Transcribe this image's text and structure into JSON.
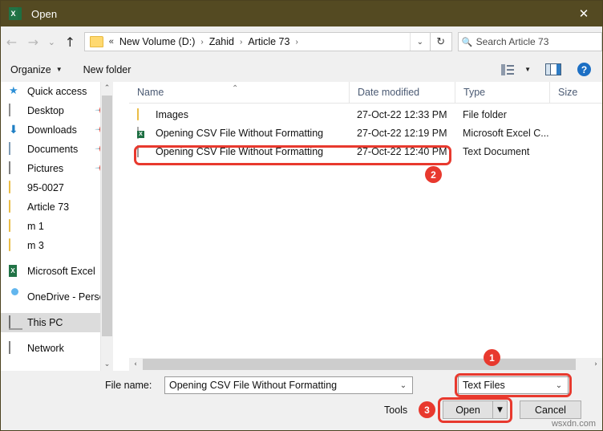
{
  "window": {
    "title": "Open",
    "app_icon": "excel-icon",
    "close_label": "✕",
    "titlebar_color": "#544a22"
  },
  "nav": {
    "back": "←",
    "forward": "→",
    "recent": "⌄",
    "up": "↑",
    "breadcrumb_overflow": "«",
    "breadcrumb": [
      "New Volume (D:)",
      "Zahid",
      "Article 73"
    ],
    "separator": "›",
    "dropdown": "⌄",
    "refresh": "↻",
    "search_placeholder": "Search Article 73",
    "search_value": "",
    "search_icon": "search-icon"
  },
  "toolbar": {
    "organize_label": "Organize",
    "organize_caret": "▼",
    "new_folder_label": "New folder",
    "view_caret": "▼",
    "view_icon": "list-view-icon",
    "preview_pane_icon": "preview-pane-icon",
    "help_label": "?"
  },
  "sidebar": {
    "items": [
      {
        "label": "Quick access",
        "icon": "star-icon",
        "pinned": false,
        "selected": false
      },
      {
        "label": "Desktop",
        "icon": "desktop-icon",
        "pinned": true,
        "selected": false
      },
      {
        "label": "Downloads",
        "icon": "download-icon",
        "pinned": true,
        "selected": false
      },
      {
        "label": "Documents",
        "icon": "documents-icon",
        "pinned": true,
        "selected": false
      },
      {
        "label": "Pictures",
        "icon": "pictures-icon",
        "pinned": true,
        "selected": false
      },
      {
        "label": "95-0027",
        "icon": "folder-icon",
        "pinned": false,
        "selected": false
      },
      {
        "label": "Article 73",
        "icon": "folder-icon",
        "pinned": false,
        "selected": false
      },
      {
        "label": "m 1",
        "icon": "folder-icon",
        "pinned": false,
        "selected": false
      },
      {
        "label": "m 3",
        "icon": "folder-icon",
        "pinned": false,
        "selected": false
      },
      {
        "label": "Microsoft Excel",
        "icon": "excel-icon",
        "pinned": false,
        "selected": false
      },
      {
        "label": "OneDrive - Personal",
        "icon": "onedrive-icon",
        "pinned": false,
        "selected": false
      },
      {
        "label": "This PC",
        "icon": "this-pc-icon",
        "pinned": false,
        "selected": true
      },
      {
        "label": "Network",
        "icon": "network-icon",
        "pinned": false,
        "selected": false
      }
    ],
    "scroll_up": "⌃",
    "scroll_down": "⌄"
  },
  "filelist": {
    "columns": [
      "Name",
      "Date modified",
      "Type",
      "Size"
    ],
    "sort_indicator": "⌃",
    "rows": [
      {
        "name": "Images",
        "date_modified": "27-Oct-22 12:33 PM",
        "type": "File folder",
        "size": "",
        "icon": "folder-icon"
      },
      {
        "name": "Opening CSV File Without Formatting",
        "date_modified": "27-Oct-22 12:19 PM",
        "type": "Microsoft Excel C...",
        "size": "",
        "icon": "excel-csv-icon"
      },
      {
        "name": "Opening CSV File Without Formatting",
        "date_modified": "27-Oct-22 12:40 PM",
        "type": "Text Document",
        "size": "",
        "icon": "text-document-icon"
      }
    ],
    "hscroll_left": "‹",
    "hscroll_right": "›"
  },
  "footer": {
    "file_name_label": "File name:",
    "file_name_value": "Opening CSV File Without Formatting",
    "file_name_placeholder": "File name",
    "file_name_caret": "⌄",
    "file_type_value": "Text Files",
    "file_type_caret": "⌄",
    "tools_label": "Tools",
    "open_label": "Open",
    "open_split_caret": "▼",
    "cancel_label": "Cancel"
  },
  "annotations": {
    "accent_color": "#e8392e",
    "marker_1": "1",
    "marker_2": "2",
    "marker_3": "3"
  },
  "watermark": "wsxdn.com"
}
